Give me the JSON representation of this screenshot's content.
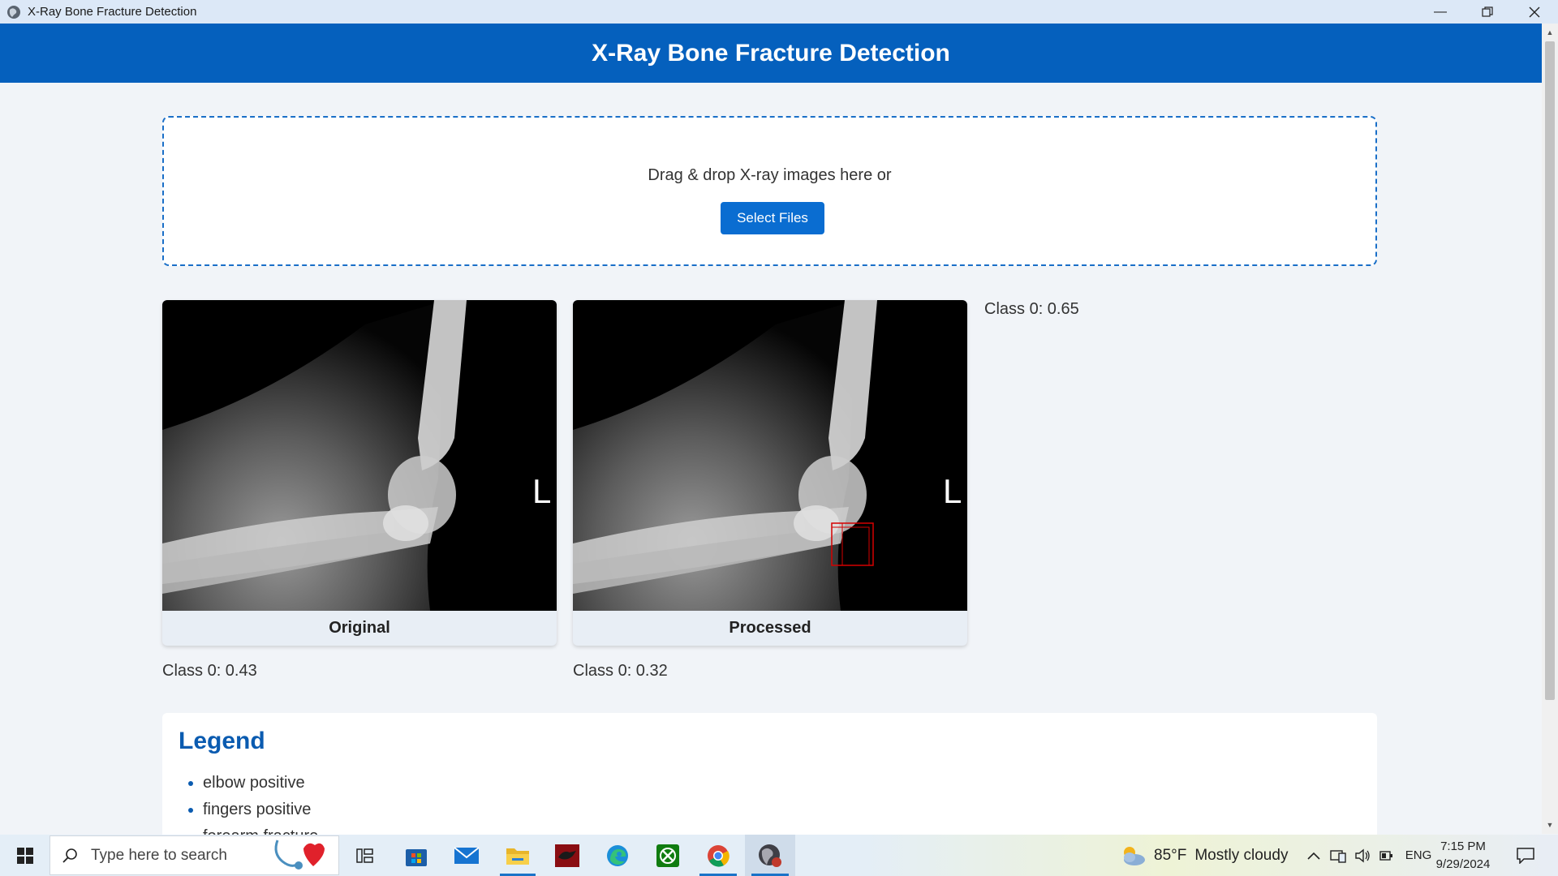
{
  "window": {
    "title": "X-Ray Bone Fracture Detection",
    "controls": [
      "minimize",
      "restore",
      "close"
    ]
  },
  "header": {
    "title": "X-Ray Bone Fracture Detection"
  },
  "upload": {
    "prompt": "Drag & drop X-ray images here or",
    "button_label": "Select Files"
  },
  "results": {
    "original": {
      "caption": "Original",
      "score": "Class 0: 0.43",
      "marker": "L"
    },
    "processed": {
      "caption": "Processed",
      "score": "Class 0: 0.32",
      "marker": "L"
    },
    "side_score": "Class 0: 0.65"
  },
  "legend": {
    "title": "Legend",
    "items": [
      "elbow positive",
      "fingers positive",
      "forearm fracture"
    ]
  },
  "taskbar": {
    "search_placeholder": "Type here to search",
    "apps": [
      "task-view",
      "microsoft-store",
      "mail",
      "file-explorer",
      "app-red",
      "edge",
      "xbox",
      "chrome",
      "app-active"
    ],
    "weather_temp": "85°F",
    "weather_text": "Mostly cloudy",
    "language": "ENG",
    "time": "7:15 PM",
    "date": "9/29/2024"
  },
  "colors": {
    "header_bg": "#0560bd",
    "button_bg": "#0a6dd1",
    "legend_title": "#0a5bb0",
    "detection_box": "#d40000"
  }
}
